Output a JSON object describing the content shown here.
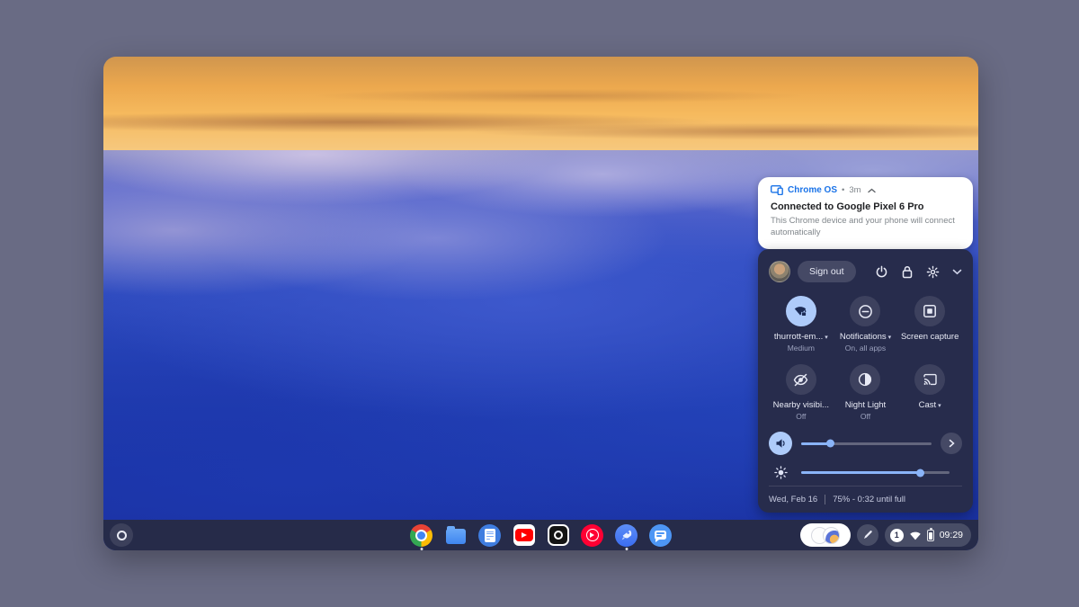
{
  "colors": {
    "outer_background": "#696b84",
    "taskbar": "#262b49",
    "panel": "#272c4c",
    "accent_blue": "#8ab4f8",
    "active_tile": "#aecbfa",
    "notification_blue": "#1a73e8",
    "wallpaper_sky": "#f6ba5e",
    "wallpaper_sea": "#2542b6"
  },
  "notification": {
    "app": "Chrome OS",
    "dot_separator": "•",
    "time": "3m",
    "title": "Connected to Google Pixel 6 Pro",
    "body": "This Chrome device and your phone will connect automatically"
  },
  "quick_settings": {
    "sign_out_label": "Sign out",
    "caret_down": "▾",
    "tiles": [
      {
        "label": "thurrott-em...",
        "sublabel": "Medium",
        "icon": "wifi-lock-icon",
        "active": true
      },
      {
        "label": "Notifications",
        "sublabel": "On, all apps",
        "icon": "do-not-disturb-icon",
        "active": false
      },
      {
        "label": "Screen capture",
        "sublabel": "",
        "icon": "screen-capture-icon",
        "active": false
      },
      {
        "label": "Nearby visibi...",
        "sublabel": "Off",
        "icon": "visibility-off-icon",
        "active": false
      },
      {
        "label": "Night Light",
        "sublabel": "Off",
        "icon": "night-light-icon",
        "active": false
      },
      {
        "label": "Cast",
        "sublabel": "",
        "icon": "cast-icon",
        "active": false
      }
    ],
    "volume_percent": 22,
    "brightness_percent": 80,
    "footer": {
      "date": "Wed, Feb 16",
      "battery_status": "75% - 0:32 until full"
    }
  },
  "taskbar": {
    "apps": [
      "chrome",
      "files",
      "docs",
      "youtube",
      "camera",
      "youtube-music",
      "explore",
      "messages"
    ],
    "running_apps": [
      "chrome",
      "explore"
    ],
    "notification_count": "1",
    "time": "09:29"
  }
}
